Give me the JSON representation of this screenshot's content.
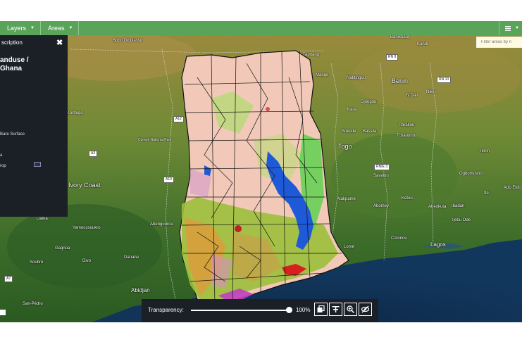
{
  "toolbar": {
    "layers_label": "Layers",
    "areas_label": "Areas"
  },
  "panel": {
    "header": "scription",
    "title_line1": "anduse /",
    "title_line2": "Ghana",
    "legend": [
      "Bare Surface",
      "a",
      "rop"
    ]
  },
  "filter": {
    "placeholder": "Filter areas by n"
  },
  "transparency": {
    "label": "Transparency:",
    "value": "100%",
    "level": 1.0
  },
  "map": {
    "places": [
      "Bobo Dioulasso",
      "Banikoara",
      "Kandi",
      "Tapoang",
      "Mango",
      "Natitingou",
      "Benin",
      "Djougou",
      "N'Dali",
      "Nikki",
      "Kara",
      "Sokodé",
      "Bassila",
      "Parakou",
      "Tchaourou",
      "Togo",
      "Korhogo",
      "Ilorin",
      "Ogbomosho",
      "Ivory Coast",
      "Savalou",
      "Atakpamé",
      "Abomey",
      "Kétou",
      "Abeokuta",
      "Ibadan",
      "Ado Ekiti",
      "Ife",
      "Ijebu Ode",
      "Daloa",
      "Yamoussoukro",
      "Abengourou",
      "Lomé",
      "Cotonou",
      "Lagos",
      "Gagnoa",
      "Dananė",
      "Soubré",
      "Divo",
      "Abidjan",
      "San-Pédro",
      "Comoé National Park"
    ],
    "roads": [
      "RN 8",
      "RN 10",
      "A12",
      "A3",
      "A10",
      "RNIE 3",
      "A7"
    ]
  }
}
